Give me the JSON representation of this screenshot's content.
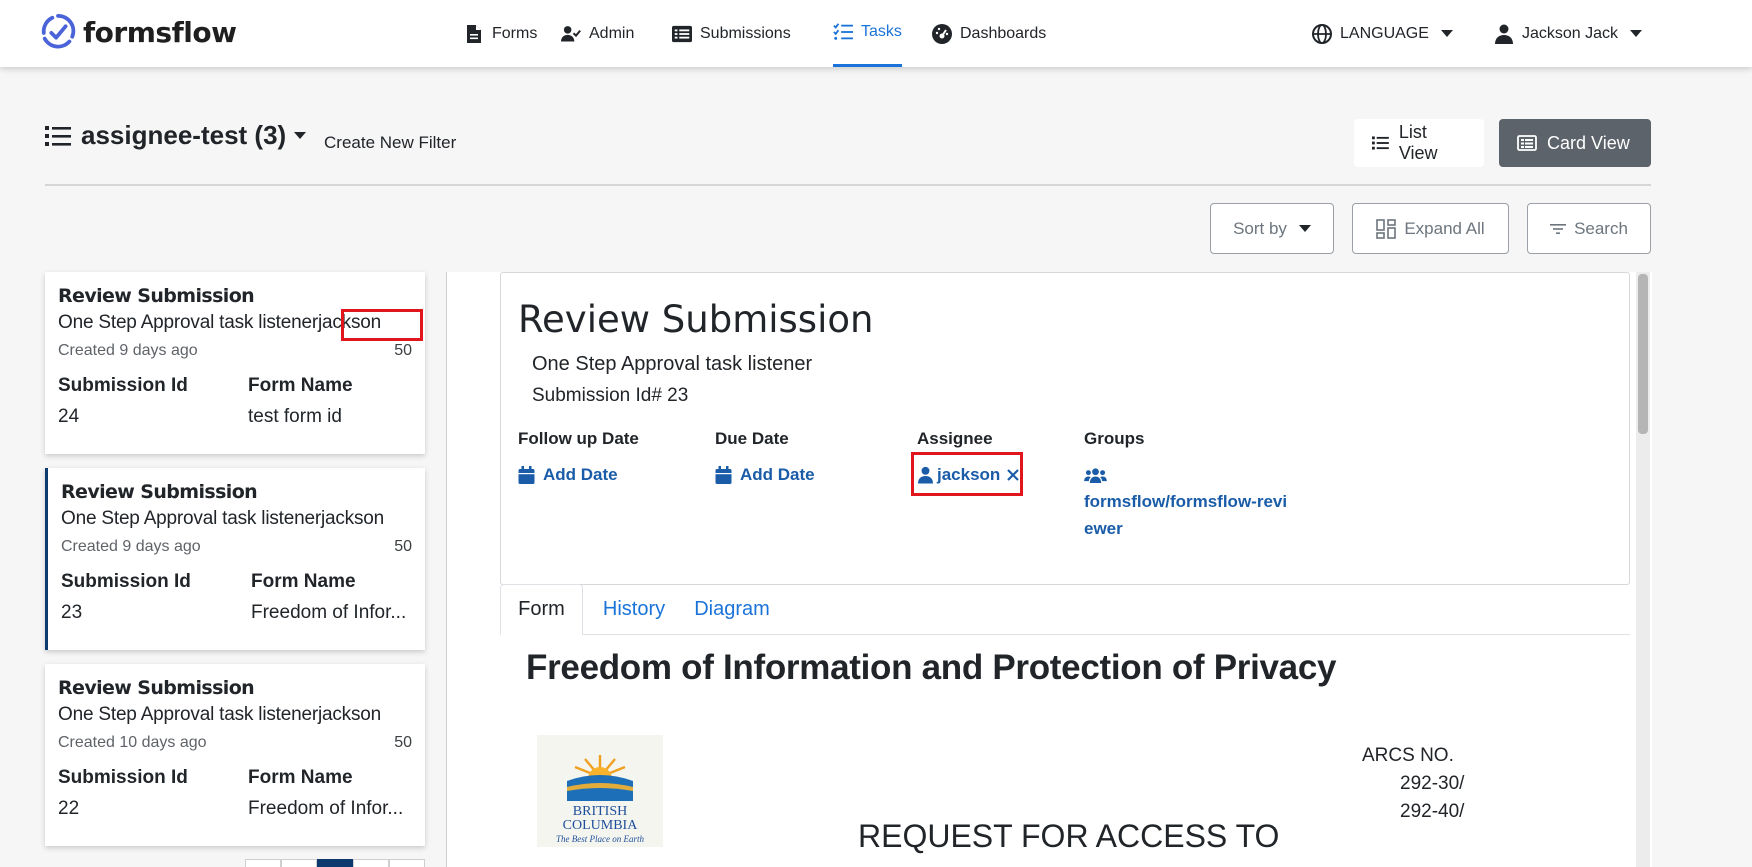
{
  "header": {
    "logo_text": "formsflow",
    "nav": [
      {
        "label": "Forms",
        "icon": "file-icon"
      },
      {
        "label": "Admin",
        "icon": "user-check-icon"
      },
      {
        "label": "Submissions",
        "icon": "list-alt-icon"
      },
      {
        "label": "Tasks",
        "icon": "tasks-icon",
        "active": true
      },
      {
        "label": "Dashboards",
        "icon": "dashboard-icon"
      }
    ],
    "language_label": "LANGUAGE",
    "user_label": "Jackson Jack",
    "accent_color": "#1a73d9"
  },
  "filter": {
    "title": "assignee-test (3)",
    "create_label": "Create New Filter",
    "list_view_label": "List View",
    "card_view_label": "Card View",
    "sort_label": "Sort by",
    "expand_label": "Expand All",
    "search_label": "Search"
  },
  "tasks": [
    {
      "title": "Review Submission",
      "subtitle": "One Step Approval task listener",
      "assignee": "jackson",
      "created": "Created 9 days ago",
      "priority": "50",
      "submission_id_label": "Submission Id",
      "submission_id": "24",
      "form_name_label": "Form Name",
      "form_name": "test form id"
    },
    {
      "title": "Review Submission",
      "subtitle": "One Step Approval task listener",
      "assignee": "jackson",
      "created": "Created 9 days ago",
      "priority": "50",
      "submission_id_label": "Submission Id",
      "submission_id": "23",
      "form_name_label": "Form Name",
      "form_name": "Freedom of Infor..."
    },
    {
      "title": "Review Submission",
      "subtitle": "One Step Approval task listener",
      "assignee": "jackson",
      "created": "Created 10 days ago",
      "priority": "50",
      "submission_id_label": "Submission Id",
      "submission_id": "22",
      "form_name_label": "Form Name",
      "form_name": "Freedom of Infor..."
    }
  ],
  "detail": {
    "title": "Review Submission",
    "subtitle": "One Step Approval task listener",
    "submission": "Submission Id# 23",
    "follow_up_label": "Follow up Date",
    "follow_up_action": "Add Date",
    "due_label": "Due Date",
    "due_action": "Add Date",
    "assignee_label": "Assignee",
    "assignee_value": "jackson",
    "groups_label": "Groups",
    "groups_line1": "formsflow/formsflow-revi",
    "groups_line2": "ewer",
    "tabs": [
      "Form",
      "History",
      "Diagram"
    ]
  },
  "form": {
    "title": "Freedom of Information and Protection of Privacy",
    "logo_line1": "BRITISH",
    "logo_line2": "COLUMBIA",
    "logo_tagline": "The Best Place on Earth",
    "arcs_label": "ARCS NO.",
    "arcs_1": "292-30/",
    "arcs_2": "292-40/",
    "request_title": "REQUEST FOR ACCESS TO"
  }
}
